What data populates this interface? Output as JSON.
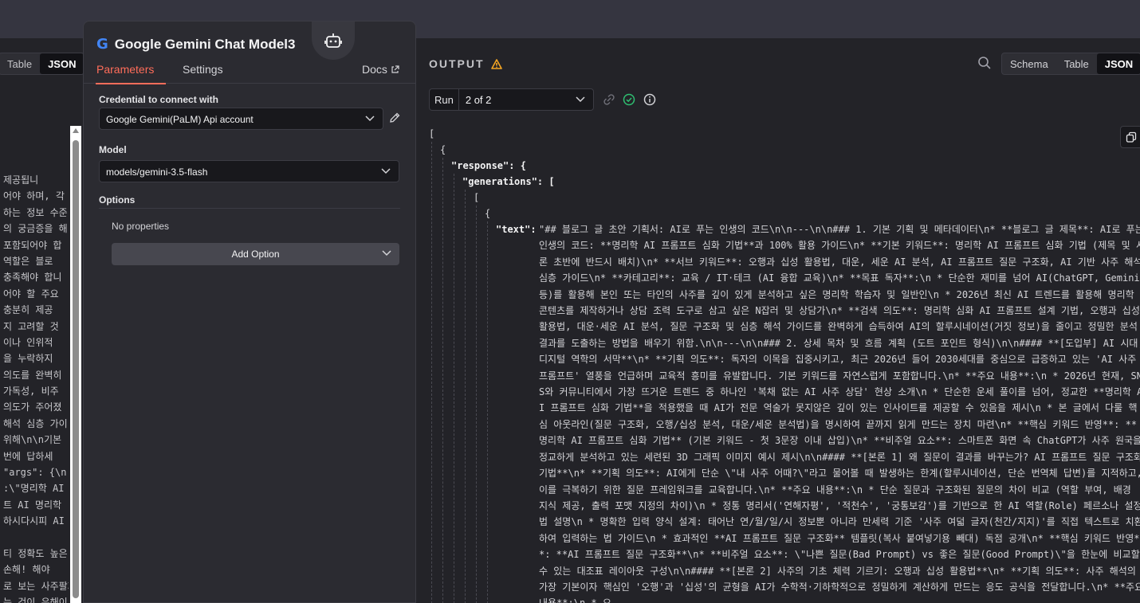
{
  "left_panel": {
    "view_options": [
      "Table",
      "JSON"
    ],
    "active_view": "JSON",
    "visible_text_lines": [
      "제공됩니",
      "어야 하며, 각",
      "하는 정보 수준",
      "의 궁금증을 해",
      "포함되어야 합",
      "역할은 블로",
      "충족해야 합니",
      "어야 할 주요",
      "충분히 제공",
      "지 고려할 것",
      "이나 인위적",
      "을 누락하지",
      "의도를 완벽히",
      "가독성, 비주",
      "의도가 주어졌",
      "해석 심층 가이",
      "위해\\n\\n기본",
      "번에 답하세",
      "\"args\": {\\n",
      ":\\\"명리학 AI",
      "트 AI 명리학",
      "하시다시피 AI",
      "",
      "티 정확도 높은",
      "손해! 해야",
      "로 보는 사주팔자",
      "는 것이 유해이"
    ]
  },
  "node": {
    "title": "Google Gemini Chat Model3",
    "logo_letter": "G",
    "tabs": {
      "parameters": "Parameters",
      "settings": "Settings",
      "docs": "Docs"
    },
    "credential_label": "Credential to connect with",
    "credential_value": "Google Gemini(PaLM) Api account",
    "model_label": "Model",
    "model_value": "models/gemini-3.5-flash",
    "options_label": "Options",
    "no_properties": "No properties",
    "add_option": "Add Option"
  },
  "output": {
    "title": "OUTPUT",
    "view_options": [
      "Schema",
      "Table",
      "JSON"
    ],
    "active_view": "JSON",
    "run_label": "Run",
    "run_value": "2 of 2",
    "json": {
      "open_bracket": "[",
      "open_brace": "{",
      "response_key": "\"response\": {",
      "generations_key": "\"generations\": [",
      "inner_bracket": "[",
      "inner_brace": "{",
      "text_key": "\"text\":",
      "text_value": "\"## 블로그 글 초안 기획서: AI로 푸는 인생의 코드\\n\\n---\\n\\n### 1. 기본 기획 및 메타데이터\\n* **블로그 글 제목**: AI로 푸는 인생의 코드: **명리학 AI 프롬프트 심화 기법**과 100% 활용 가이드\\n* **기본 키워드**: 명리학 AI 프롬프트 심화 기법 (제목 및 서론 초반에 반드시 배치)\\n* **서브 키워드**: 오행과 십성 활용법, 대운, 세운 AI 분석, AI 프롬프트 질문 구조화, AI 기반 사주 해석 심층 가이드\\n* **카테고리**: 교육 / IT·테크 (AI 융합 교육)\\n* **목표 독자**:\\n  * 단순한 재미를 넘어 AI(ChatGPT, Gemini 등)를 활용해 본인 또는 타인의 사주를 깊이 있게 분석하고 싶은 명리학 학습자 및 일반인\\n  * 2026년 최신 AI 트렌드를 활용해 명리학 콘텐츠를 제작하거나 상담 조력 도구로 삼고 싶은 N잡러 및 상담가\\n* **검색 의도**: 명리학 심화 AI 프롬프트 설계 기법, 오행과 십성 활용법, 대운·세운 AI 분석, 질문 구조화 및 심층 해석 가이드를 완벽하게 습득하여 AI의 할루시네이션(거짓 정보)을 줄이고 정밀한 분석 결과를 도출하는 방법을 배우기 위함.\\n\\n---\\n\\n### 2. 상세 목차 및 흐름 계획 (도트 포인트 형식)\\n\\n#### **[도입부] AI 시대, 디지털 역학의 서막**\\n* **기획 의도**: 독자의 이목을 집중시키고, 최근 2026년 들어 2030세대를 중심으로 급증하고 있는 'AI 사주 프롬프트' 열풍을 언급하며 교육적 흥미를 유발합니다. 기본 키워드를 자연스럽게 포함합니다.\\n* **주요 내용**:\\n  * 2026년 현재, SNS와 커뮤니티에서 가장 뜨거운 트렌드 중 하나인 '복채 없는 AI 사주 상담' 현상 소개\\n  * 단순한 운세 풀이를 넘어, 정교한 **명리학 AI 프롬프트 심화 기법**을 적용했을 때 AI가 전문 역술가 못지않은 깊이 있는 인사이트를 제공할 수 있음을 제시\\n  * 본 글에서 다룰 핵심 아웃라인(질문 구조화, 오행/십성 분석, 대운/세운 분석법)을 명시하여 끝까지 읽게 만드는 장치 마련\\n* **핵심 키워드 반영**: **명리학 AI 프롬프트 심화 기법** (기본 키워드 - 첫 3문장 이내 삽입)\\n* **비주얼 요소**: 스마트폰 화면 속 ChatGPT가 사주 원국을 정교하게 분석하고 있는 세련된 3D 그래픽 이미지 예시 제시\\n\\n#### **[본론 1] 왜 질문이 결과를 바꾸는가? AI 프롬프트 질문 구조화 기법**\\n* **기획 의도**: AI에게 단순 \\\"내 사주 어때?\\\"라고 물어볼 때 발생하는 한계(할루시네이션, 단순 번역체 답변)를 지적하고, 이를 극복하기 위한 질문 프레임워크를 교육합니다.\\n* **주요 내용**:\\n  * 단순 질문과 구조화된 질문의 차이 비교 (역할 부여, 배경 지식 제공, 출력 포맷 지정의 차이)\\n  * 정통 명리서('연해자평', '적천수', '궁통보감')를 기반으로 한 AI 역할(Role) 페르소나 설정법 설명\\n  * 명확한 입력 양식 설계: 태어난 연/월/일/시 정보뿐 아니라 만세력 기준 '사주 여덟 글자(천간/지지)'를 직접 텍스트로 치환하여 입력하는 법 가이드\\n  * 효과적인 **AI 프롬프트 질문 구조화** 템플릿(복사 붙여넣기용 빼대) 독점 공개\\n* **핵심 키워드 반영**: **AI 프롬프트 질문 구조화**\\n* **비주얼 요소**: \\\"나쁜 질문(Bad Prompt) vs 좋은 질문(Good Prompt)\\\"을 한눈에 비교할 수 있는 대조표 레이아웃 구성\\n\\n#### **[본론 2] 사주의 기초 체력 기르기: 오행과 십성 활용법**\\n* **기획 의도**: 사주 해석의 가장 기본이자 핵심인 '오행'과 '십성'의 균형을 AI가 수학적·기하학적으로 정밀하게 계산하게 만드는 응도 공식을 전달합니다.\\n* **주요 내용**:\\n  * 오"
    }
  }
}
